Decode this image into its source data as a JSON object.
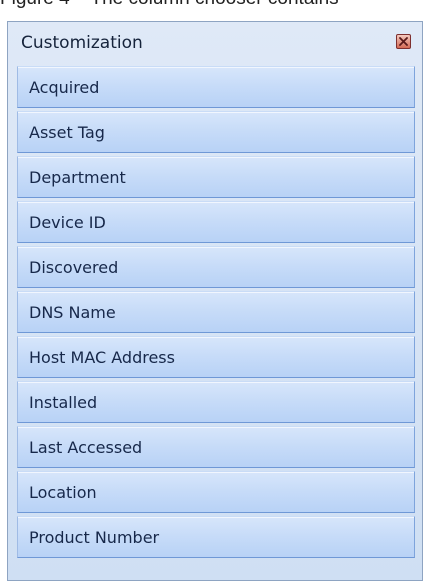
{
  "document": {
    "caption": "Figure 4 – The column chooser contains"
  },
  "panel": {
    "title": "Customization",
    "close_icon": "close-icon",
    "items": [
      {
        "label": "Acquired"
      },
      {
        "label": "Asset Tag"
      },
      {
        "label": "Department"
      },
      {
        "label": "Device ID"
      },
      {
        "label": "Discovered"
      },
      {
        "label": "DNS Name"
      },
      {
        "label": "Host MAC Address"
      },
      {
        "label": "Installed"
      },
      {
        "label": "Last Accessed"
      },
      {
        "label": "Location"
      },
      {
        "label": "Product Number"
      }
    ]
  },
  "colors": {
    "close_button": "#d46a55",
    "row_fill": "#c6dbf8",
    "row_border": "#6f98d6",
    "panel_bg": "#dfe9f7"
  }
}
